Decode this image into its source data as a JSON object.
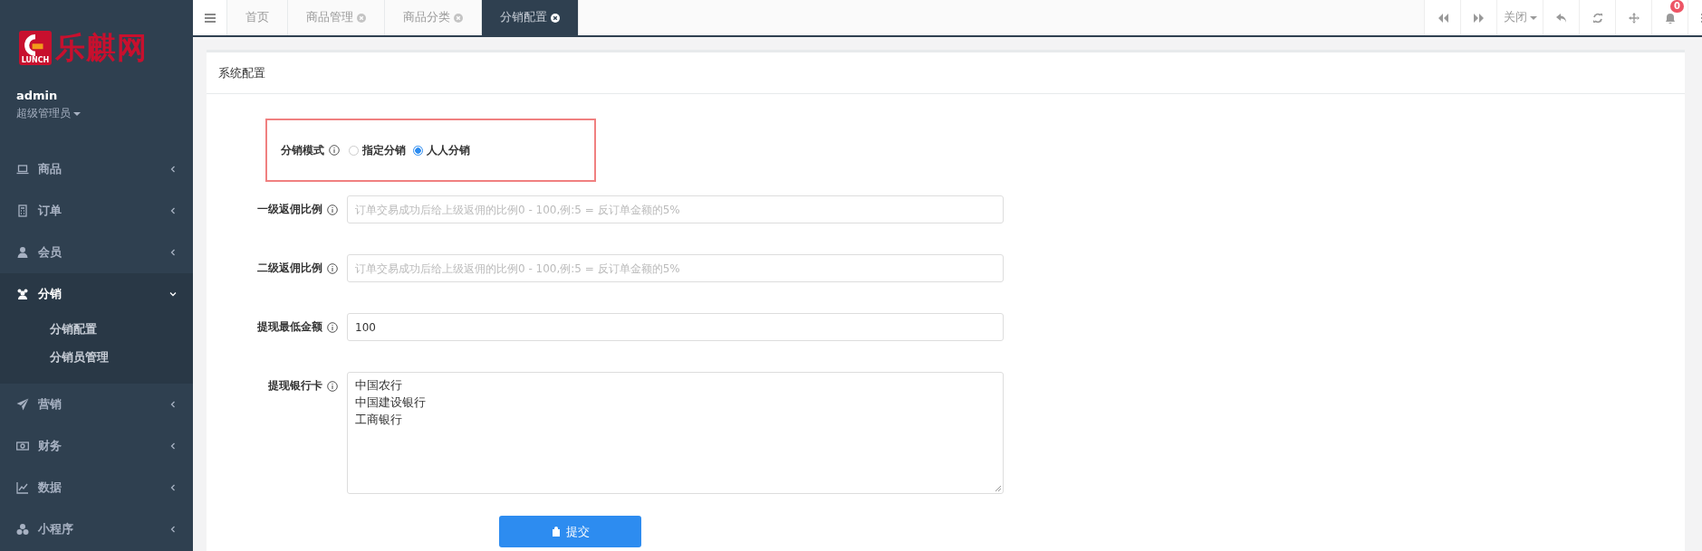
{
  "sidebar": {
    "logo": {
      "badge": "LUNCH",
      "text": "乐麒网"
    },
    "user": {
      "name": "admin",
      "role": "超级管理员"
    },
    "menu": [
      {
        "label": "商品",
        "expanded": false
      },
      {
        "label": "订单",
        "expanded": false
      },
      {
        "label": "会员",
        "expanded": false
      },
      {
        "label": "分销",
        "expanded": true,
        "children": [
          {
            "label": "分销配置"
          },
          {
            "label": "分销员管理"
          }
        ]
      },
      {
        "label": "营销",
        "expanded": false
      },
      {
        "label": "财务",
        "expanded": false
      },
      {
        "label": "数据",
        "expanded": false
      },
      {
        "label": "小程序",
        "expanded": false
      }
    ]
  },
  "tabs": [
    {
      "label": "首页",
      "closable": false,
      "selected": false
    },
    {
      "label": "商品管理",
      "closable": true,
      "selected": false
    },
    {
      "label": "商品分类",
      "closable": true,
      "selected": false
    },
    {
      "label": "分销配置",
      "closable": true,
      "selected": true
    }
  ],
  "toolbar": {
    "close_menu": "关闭",
    "notification_count": "0"
  },
  "panel": {
    "title": "系统配置",
    "fields": [
      {
        "kind": "radio",
        "label": "分销模式",
        "highlighted": true,
        "options": [
          {
            "label": "指定分销",
            "selected": false
          },
          {
            "label": "人人分销",
            "selected": true
          }
        ]
      },
      {
        "kind": "text",
        "label": "一级返佣比例",
        "placeholder": "订单交易成功后给上级返佣的比例0 - 100,例:5 = 反订单金额的5%"
      },
      {
        "kind": "text",
        "label": "二级返佣比例",
        "placeholder": "订单交易成功后给上级返佣的比例0 - 100,例:5 = 反订单金额的5%"
      },
      {
        "kind": "text",
        "label": "提现最低金额",
        "value": "100"
      },
      {
        "kind": "textarea",
        "label": "提现银行卡",
        "lines": [
          "中国农行",
          "中国建设银行",
          "工商银行"
        ]
      }
    ],
    "submit": "提交"
  }
}
